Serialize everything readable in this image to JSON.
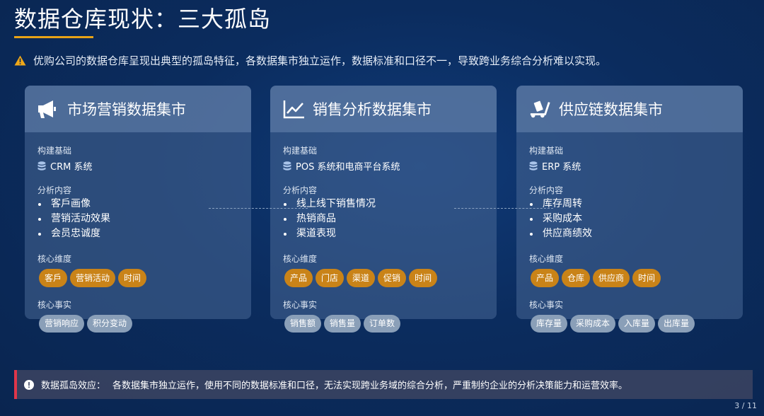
{
  "page": {
    "title": "数据仓库现状：三大孤岛",
    "intro": "优购公司的数据仓库呈现出典型的孤岛特征，各数据集市独立运作，数据标准和口径不一，导致跨业务综合分析难以实现。",
    "page_number": "3 / 11"
  },
  "labels": {
    "base": "构建基础",
    "analysis": "分析内容",
    "dimensions": "核心维度",
    "facts": "核心事实"
  },
  "cards": [
    {
      "icon": "megaphone-icon",
      "title": "市场营销数据集市",
      "base": "CRM 系统",
      "analysis": [
        "客戶画像",
        "营销活动效果",
        "会员忠诚度"
      ],
      "dimensions": [
        "客戶",
        "营销活动",
        "时间"
      ],
      "facts": [
        "营销响应",
        "积分变动"
      ]
    },
    {
      "icon": "line-chart-icon",
      "title": "销售分析数据集市",
      "base": "POS 系统和电商平台系统",
      "analysis": [
        "线上线下销售情况",
        "热销商品",
        "渠道表现"
      ],
      "dimensions": [
        "产品",
        "门店",
        "渠道",
        "促销",
        "时间"
      ],
      "facts": [
        "销售额",
        "销售量",
        "订单数"
      ]
    },
    {
      "icon": "hand-truck-icon",
      "title": "供应链数据集市",
      "base": "ERP 系统",
      "analysis": [
        "库存周转",
        "采购成本",
        "供应商绩效"
      ],
      "dimensions": [
        "产品",
        "仓库",
        "供应商",
        "时间"
      ],
      "facts": [
        "库存量",
        "采购成本",
        "入库量",
        "出库量"
      ]
    }
  ],
  "bottom": {
    "label": "数据孤岛效应：",
    "text": "各数据集市独立运作，使用不同的数据标准和口径，无法实现跨业务域的综合分析，严重制约企业的分析决策能力和运营效率。"
  },
  "colors": {
    "accent_orange": "#c98318",
    "underline": "#e8a317",
    "tag_gray": "#8a9fb8",
    "alert_red": "#e0364a"
  }
}
